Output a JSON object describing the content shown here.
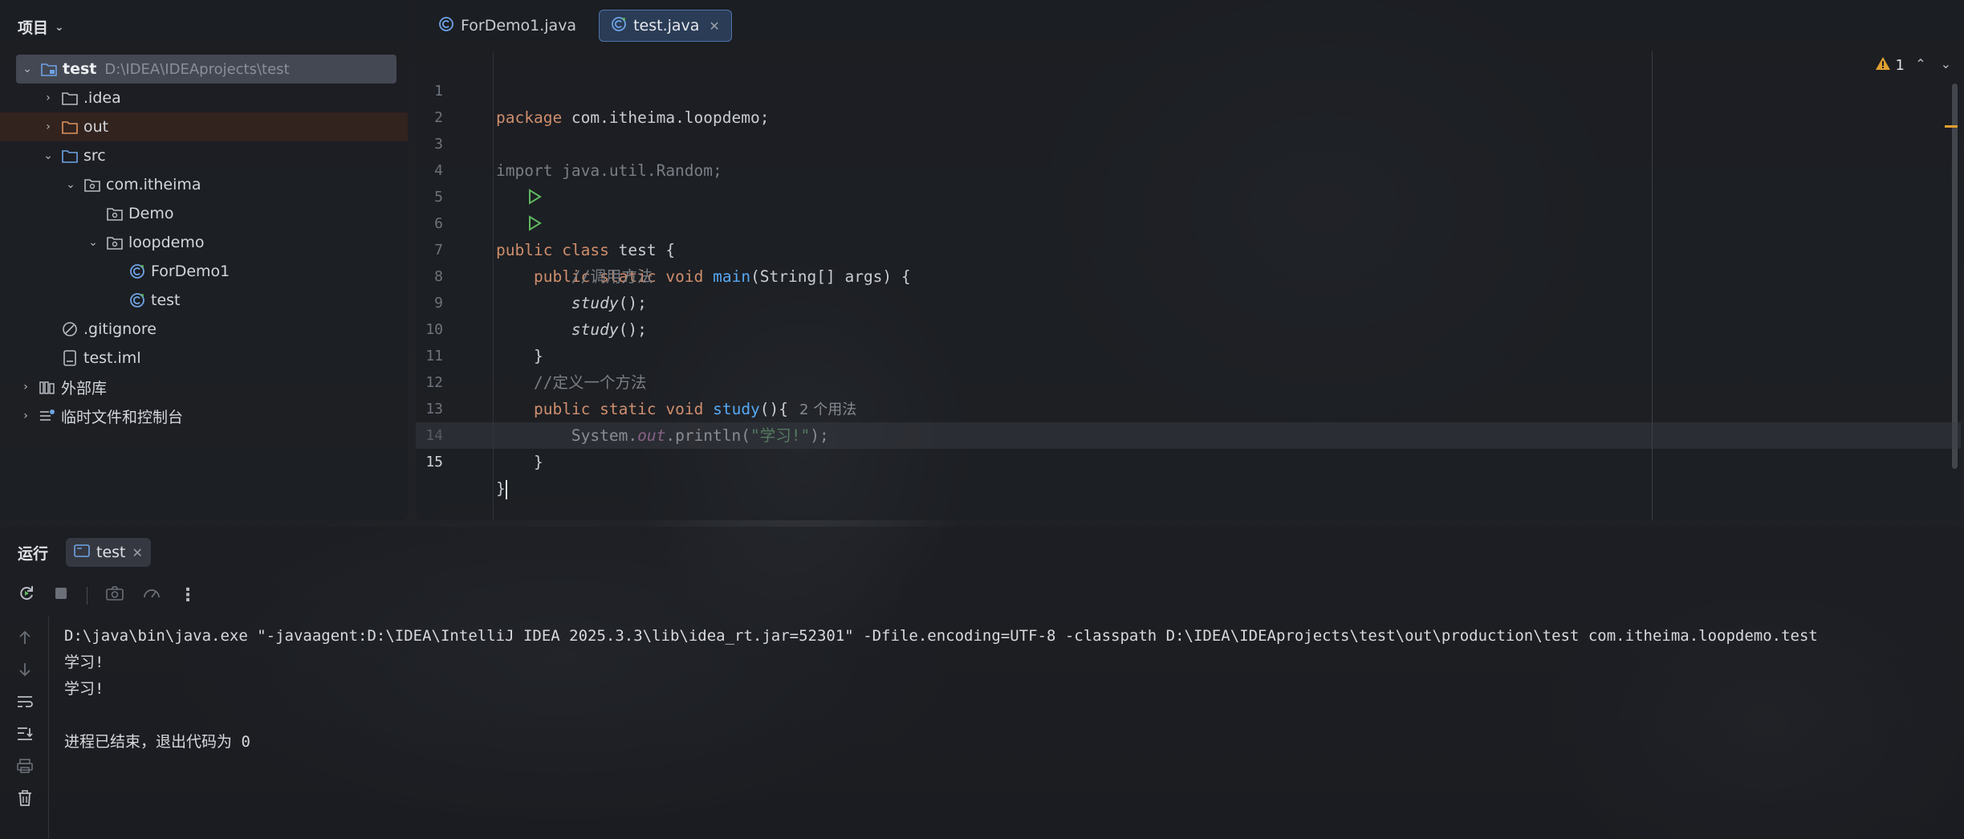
{
  "project": {
    "title": "项目",
    "tree": [
      {
        "label": "test",
        "hint": "D:\\IDEA\\IDEAprojects\\test",
        "depth": 0,
        "chevron": "down",
        "icon": "module-folder-icon",
        "selected": true
      },
      {
        "label": ".idea",
        "depth": 1,
        "chevron": "right",
        "icon": "folder-icon"
      },
      {
        "label": "out",
        "depth": 1,
        "chevron": "right",
        "icon": "excluded-folder-icon",
        "excluded": true
      },
      {
        "label": "src",
        "depth": 1,
        "chevron": "down",
        "icon": "source-folder-icon"
      },
      {
        "label": "com.itheima",
        "depth": 2,
        "chevron": "down",
        "icon": "package-icon"
      },
      {
        "label": "Demo",
        "depth": 3,
        "chevron": "",
        "icon": "package-icon"
      },
      {
        "label": "loopdemo",
        "depth": 3,
        "chevron": "down",
        "icon": "package-icon"
      },
      {
        "label": "ForDemo1",
        "depth": 4,
        "chevron": "",
        "icon": "java-class-icon"
      },
      {
        "label": "test",
        "depth": 4,
        "chevron": "",
        "icon": "java-class-icon"
      },
      {
        "label": ".gitignore",
        "depth": 1,
        "chevron": "",
        "icon": "ignore-file-icon"
      },
      {
        "label": "test.iml",
        "depth": 1,
        "chevron": "",
        "icon": "iml-file-icon"
      },
      {
        "label": "外部库",
        "depth": 0,
        "chevron": "right",
        "icon": "library-icon"
      },
      {
        "label": "临时文件和控制台",
        "depth": 0,
        "chevron": "right",
        "icon": "scratch-icon"
      }
    ]
  },
  "editor": {
    "tabs": [
      {
        "label": "ForDemo1.java",
        "active": false
      },
      {
        "label": "test.java",
        "active": true
      }
    ],
    "warnings": "1",
    "lines": {
      "l1": {
        "num": "1",
        "kw": "package",
        "rest": " com.itheima.loopdemo;"
      },
      "l2": {
        "num": "2"
      },
      "l3": {
        "num": "3",
        "text": "import java.util.Random;"
      },
      "l4": {
        "num": "4"
      },
      "l5": {
        "num": "5",
        "kw1": "public",
        "kw2": "class",
        "rest": " test {"
      },
      "l6": {
        "num": "6",
        "kw1": "public",
        "kw2": "static",
        "kw3": "void",
        "fn": "main",
        "rest": "(String[] args) {"
      },
      "l7": {
        "num": "7",
        "comment": "//调用方法"
      },
      "l8": {
        "num": "8",
        "call": "study",
        "rest": "();"
      },
      "l9": {
        "num": "9",
        "call": "study",
        "rest": "();"
      },
      "l10": {
        "num": "10",
        "rest": "}"
      },
      "l11": {
        "num": "11",
        "comment": "//定义一个方法"
      },
      "l12": {
        "num": "12",
        "kw1": "public",
        "kw2": "static",
        "kw3": "void",
        "fn": "study",
        "rest": "(){",
        "hint": "2 个用法"
      },
      "l13": {
        "num": "13",
        "pre": "System.",
        "field": "out",
        "mid": ".println(",
        "str": "\"学习!\"",
        "rest": ");"
      },
      "l14": {
        "num": "14",
        "rest": "}"
      },
      "l15": {
        "num": "15",
        "rest": "}"
      }
    }
  },
  "run": {
    "title": "运行",
    "tab": "test",
    "console": [
      "D:\\java\\bin\\java.exe \"-javaagent:D:\\IDEA\\IntelliJ IDEA 2025.3.3\\lib\\idea_rt.jar=52301\" -Dfile.encoding=UTF-8 -classpath D:\\IDEA\\IDEAprojects\\test\\out\\production\\test com.itheima.loopdemo.test",
      "学习!",
      "学习!",
      "",
      "进程已结束，退出代码为 0"
    ]
  },
  "colors": {
    "keyword": "#cf8e6d",
    "function": "#56a8f5",
    "string": "#6aab73",
    "comment": "#7a7e85",
    "field": "#c77dbb",
    "run_icon": "#5fb85f"
  }
}
